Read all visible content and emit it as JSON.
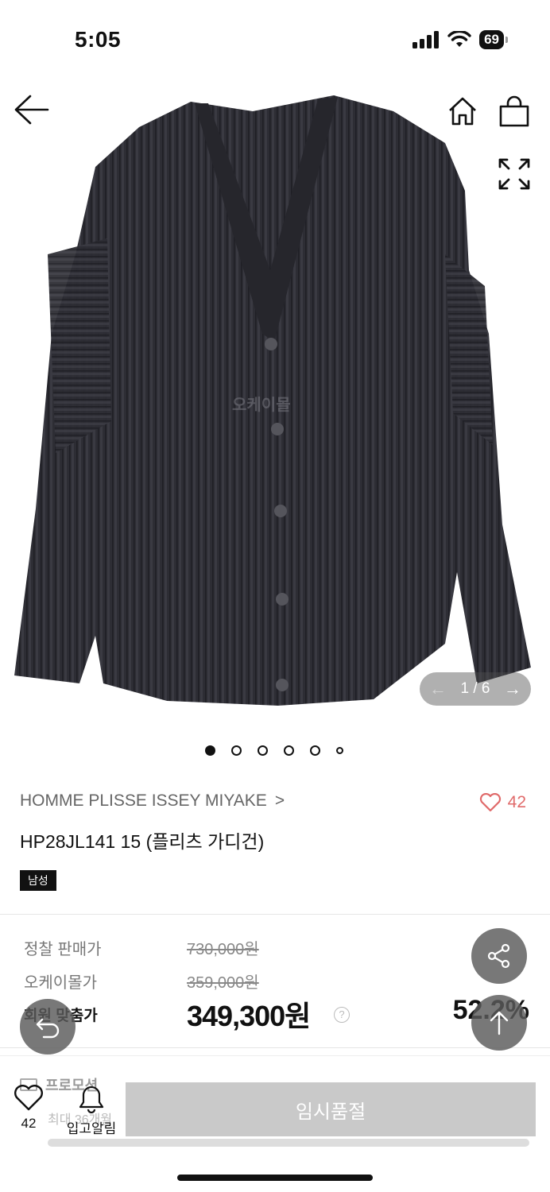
{
  "status": {
    "time": "5:05",
    "battery": "69"
  },
  "gallery": {
    "watermark": "오케이몰",
    "current": "1 / 6",
    "total_dots": 6
  },
  "product": {
    "brand": "HOMME PLISSE ISSEY MIYAKE",
    "brand_chevron": ">",
    "name": "HP28JL141 15 (플리츠 가디건)",
    "gender_tag": "남성",
    "like_count": "42"
  },
  "pricing": {
    "list_label": "정찰 판매가",
    "list_price": "730,000원",
    "okmall_label": "오케이몰가",
    "okmall_price": "359,000원",
    "member_label": "회원 맞춤가",
    "member_price": "349,300원",
    "help": "?",
    "discount": "52.2%"
  },
  "promo": {
    "label": "프로모션",
    "sub": "최대 36개월"
  },
  "bottom": {
    "wish_count": "42",
    "restock_label": "입고알림",
    "soldout_label": "임시품절"
  },
  "colors": {
    "garment": "#2c2c33",
    "heart": "#e06a6a",
    "soldout": "#c9c9c9"
  }
}
